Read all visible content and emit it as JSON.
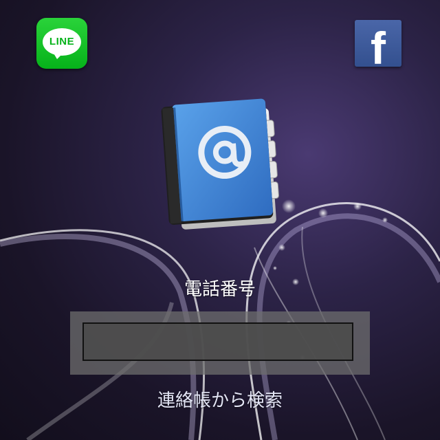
{
  "apps": {
    "line": {
      "label": "LINE",
      "icon": "line-chat-icon",
      "color": "#06b21a"
    },
    "facebook": {
      "label": "f",
      "icon": "facebook-icon",
      "color": "#3b5998"
    }
  },
  "contacts_icon": {
    "icon": "address-book-icon",
    "glyph": "@"
  },
  "form": {
    "phone_label": "電話番号",
    "phone_value": "",
    "search_link": "連絡帳から検索"
  },
  "colors": {
    "background": "#2c2347",
    "book_blue": "#3f86d8"
  }
}
